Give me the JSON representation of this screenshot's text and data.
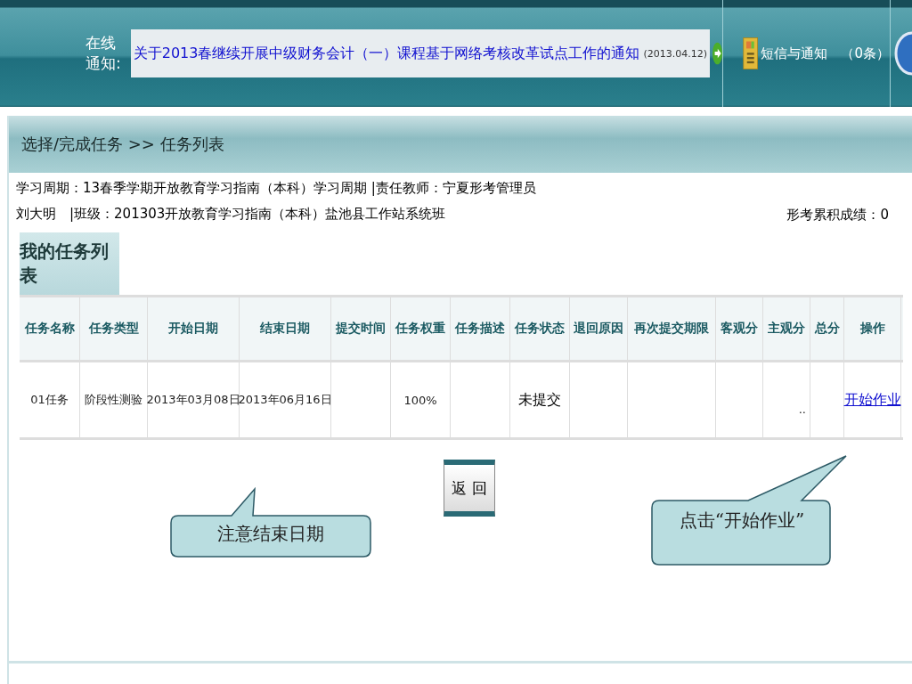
{
  "header": {
    "notice_label": "在线通知:",
    "notice_title": "关于2013春继续开展中级财务会计（一）课程基于网络考核改革试点工作的通知",
    "notice_date": "(2013.04.12)",
    "messages_label": "短信与通知",
    "messages_count": "（0条）"
  },
  "breadcrumb": "选择/完成任务 >> 任务列表",
  "info": {
    "line_1": "学习周期：13春季学期开放教育学习指南（本科）学习周期 |责任教师：宁夏形考管理员",
    "line_2": "刘大明　|班级：201303开放教育学习指南（本科）盐池县工作站系统班",
    "score": "形考累积成绩：0"
  },
  "tab": "我的任务列表",
  "table": {
    "columns": [
      "任务名称",
      "任务类型",
      "开始日期",
      "结束日期",
      "提交时间",
      "任务权重",
      "任务描述",
      "任务状态",
      "退回原因",
      "再次提交期限",
      "客观分",
      "主观分",
      "总分",
      "操作"
    ],
    "rows": [
      {
        "cells": [
          {
            "text": "01任务"
          },
          {
            "text": "阶段性测验"
          },
          {
            "text": "2013年03月08日"
          },
          {
            "text": "2013年06月16日"
          },
          {},
          {
            "text": "100%"
          },
          {},
          {
            "text": "未提交",
            "kind": "status"
          },
          {},
          {},
          {},
          {
            "text": "..",
            "kind": "right"
          },
          {},
          {
            "text": "开始作业",
            "kind": "link"
          }
        ]
      }
    ]
  },
  "back_button": "返 回",
  "callouts": [
    {
      "text": "注意结束日期",
      "kind": "left"
    },
    {
      "text": "点击“开始作业”",
      "kind": "right"
    }
  ]
}
